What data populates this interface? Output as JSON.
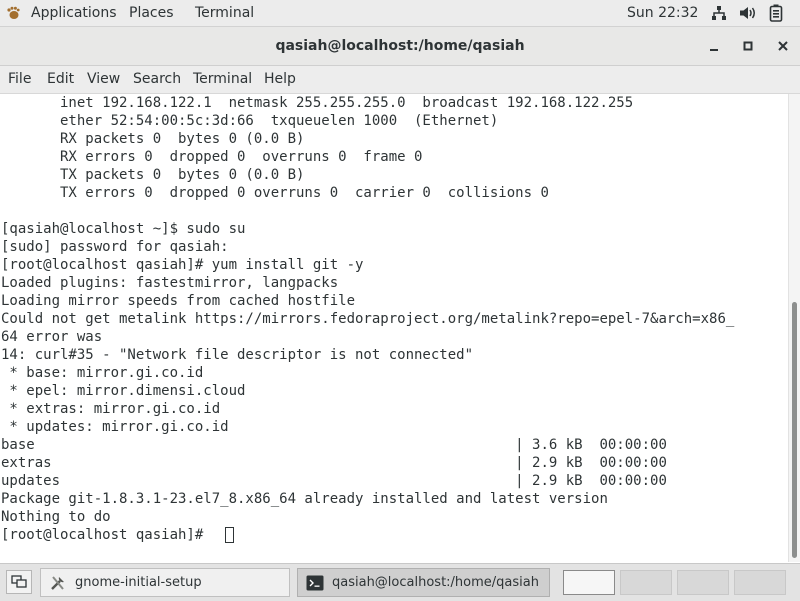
{
  "top_panel": {
    "applications": "Applications",
    "places": "Places",
    "terminal": "Terminal",
    "clock": "Sun 22:32",
    "icons": [
      "network-icon",
      "volume-icon",
      "battery-icon"
    ]
  },
  "window": {
    "title": "qasiah@localhost:/home/qasiah",
    "controls": [
      "minimize",
      "maximize",
      "close"
    ]
  },
  "menubar": {
    "items": [
      "File",
      "Edit",
      "View",
      "Search",
      "Terminal",
      "Help"
    ]
  },
  "terminal": {
    "lines": [
      "       inet 192.168.122.1  netmask 255.255.255.0  broadcast 192.168.122.255",
      "       ether 52:54:00:5c:3d:66  txqueuelen 1000  (Ethernet)",
      "       RX packets 0  bytes 0 (0.0 B)",
      "       RX errors 0  dropped 0  overruns 0  frame 0",
      "       TX packets 0  bytes 0 (0.0 B)",
      "       TX errors 0  dropped 0 overruns 0  carrier 0  collisions 0",
      "",
      "[qasiah@localhost ~]$ sudo su",
      "[sudo] password for qasiah:",
      "[root@localhost qasiah]# yum install git -y",
      "Loaded plugins: fastestmirror, langpacks",
      "Loading mirror speeds from cached hostfile",
      "Could not get metalink https://mirrors.fedoraproject.org/metalink?repo=epel-7&arch=x86_",
      "64 error was",
      "14: curl#35 - \"Network file descriptor is not connected\"",
      " * base: mirror.gi.co.id",
      " * epel: mirror.dimensi.cloud",
      " * extras: mirror.gi.co.id",
      " * updates: mirror.gi.co.id",
      "base                                                         | 3.6 kB  00:00:00",
      "extras                                                       | 2.9 kB  00:00:00",
      "updates                                                      | 2.9 kB  00:00:00",
      "Package git-1.8.3.1-23.el7_8.x86_64 already installed and latest version",
      "Nothing to do",
      "[root@localhost qasiah]# "
    ]
  },
  "taskbar": {
    "tasks": [
      {
        "label": "gnome-initial-setup",
        "icon": "setup-tools-icon",
        "active": false
      },
      {
        "label": "qasiah@localhost:/home/qasiah",
        "icon": "terminal-icon",
        "active": true
      }
    ],
    "workspaces": 4,
    "active_workspace": 1
  },
  "colors": {
    "panel_bg": "#ececec",
    "terminal_fg": "#2e3436",
    "terminal_bg": "#ffffff",
    "task_active": "#cfcfcf"
  }
}
